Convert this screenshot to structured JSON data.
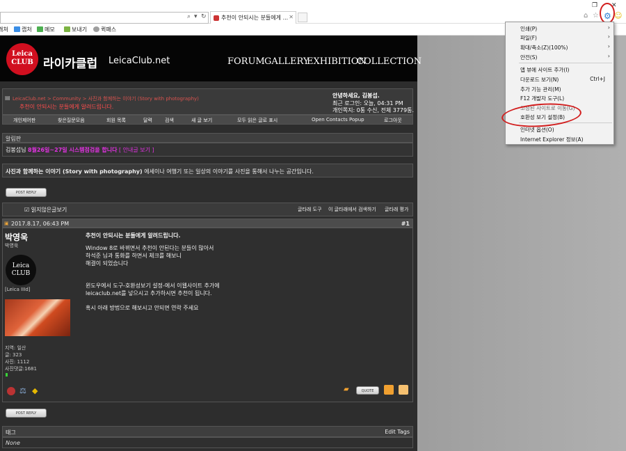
{
  "browser": {
    "address_partial": "",
    "tab_title": "추천이 안되시는 분들에게 ...",
    "favorites": [
      "캐쳐",
      "캡처",
      "메모",
      "보내기",
      "퀵패스"
    ]
  },
  "site": {
    "logo_text_1": "Leica",
    "logo_text_2": "CLUB",
    "name_kr": "라이카클럽",
    "domain": "LeicaClub.net",
    "nav": [
      "FORUM",
      "GALLERY",
      "EXHIBITION",
      "COLLECTION"
    ]
  },
  "breadcrumb": {
    "path": "LeicaClub.net > Community > 사진과 함께하는 이야기 (Story with photography)",
    "current": "추천이 안되시는 분들에게 알려드립니다."
  },
  "user_panel": {
    "greeting": "안녕하세요, 김봉섭.",
    "last_login": "최근 로그인: 오늘, 04:31 PM",
    "messages": "개인쪽지: 0통 수신, 전체 3779통."
  },
  "nav_row": [
    "개인제어판",
    "찾은질문모음",
    "회원 목록",
    "달력",
    "검색",
    "새 글 보기",
    "모두 읽은 글로 표시",
    "Open Contacts Popup",
    "로그아웃"
  ],
  "notice": {
    "header": "알림판",
    "name": "김봉섭님",
    "message": "8월26일~27일 시스템점검을 합니다",
    "link": "[ 안내글 보기 ]"
  },
  "forum_desc": {
    "title": "사진과 함께하는 이야기 (Story with photography)",
    "text": "에세이나 여행기 또는 일상의 이야기를 사진을 통해서 나누는 공간입니다."
  },
  "buttons": {
    "post_reply": "POST REPLY",
    "quote": "QUOTE"
  },
  "toolbar": {
    "unread": "읽지않은글보기",
    "tools": "글타래 도구",
    "search": "이 글타래에서 검색하기",
    "rate": "글타래 평가"
  },
  "post": {
    "date": "2017.8.17, 06:43 PM",
    "number": "#1",
    "author": "박영욱",
    "author_sub": "박영욱",
    "avatar_text_1": "Leica",
    "avatar_text_2": "CLUB",
    "camera": "[Leica IIId]",
    "region": "지역: 일산",
    "posts": "글: 323",
    "photos": "사진: 1112",
    "photo_comments": "사진댓글:1681",
    "title": "추천이 안되시는 분들에게 알려드립니다.",
    "lines": [
      "Window 8로 바뀌면서 추천이 안된다는 분들이 많아서",
      "하석준 님과 통화를 하면서 체크를 해보니",
      "해결이 되었습니다",
      "",
      "윈도우에서 도구-호환성보기 설정-에서 이웹사이트 추가에",
      "leicaclub.net를 넣으시고 추가하시면 추천이 됩니다.",
      "",
      "혹시 아래 방법으로 해보시고 안되면 연락 주세요"
    ]
  },
  "tags": {
    "label": "태그",
    "edit": "Edit Tags",
    "value": "None"
  },
  "tools_menu": {
    "items": [
      {
        "label": "인쇄(P)",
        "arrow": true
      },
      {
        "label": "파일(F)",
        "arrow": true
      },
      {
        "label": "확대/축소(Z)(100%)",
        "arrow": true
      },
      {
        "label": "안전(S)",
        "arrow": true
      },
      {
        "label": "앱 뷰에 사이트 추가(I)",
        "arrow": false
      },
      {
        "label": "다운로드 보기(N)",
        "shortcut": "Ctrl+J"
      },
      {
        "label": "추가 기능 관리(M)",
        "arrow": false
      },
      {
        "label": "F12 개발자 도구(L)",
        "arrow": false
      },
      {
        "label": "고정된 사이트로 이동(G)",
        "arrow": false
      },
      {
        "label": "호환성 보기 설정(B)",
        "arrow": false
      },
      {
        "label": "인터넷 옵션(O)",
        "arrow": false
      },
      {
        "label": "Internet Explorer 정보(A)",
        "arrow": false
      }
    ]
  },
  "colors": {
    "accent_red": "#d21d1d",
    "logo_red": "#d10f1f",
    "notice_pink": "#e032e0"
  }
}
